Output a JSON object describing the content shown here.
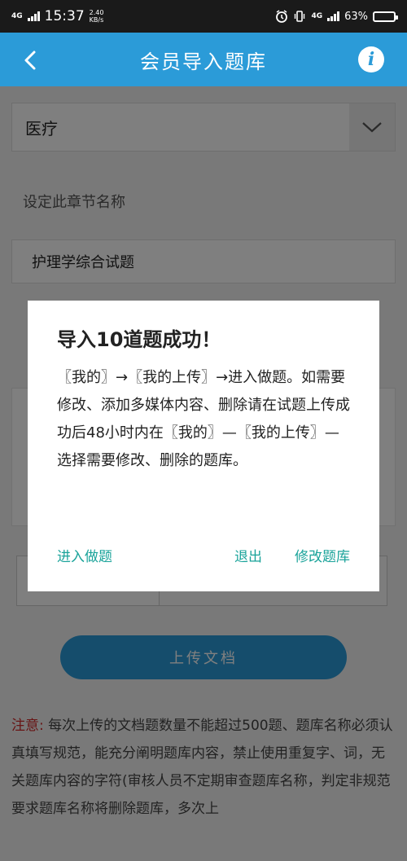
{
  "status_bar": {
    "network": "4G",
    "time": "15:37",
    "speed_value": "2.40",
    "speed_unit": "KB/s",
    "network_right": "4G",
    "battery_text": "63%",
    "battery_level": 0.63
  },
  "header": {
    "title": "会员导入题库",
    "back_icon": "chevron-left-icon",
    "info_icon": "info-icon",
    "info_glyph": "i"
  },
  "form": {
    "category_value": "医疗",
    "chapter_label": "设定此章节名称",
    "chapter_value": "护理学综合试题",
    "upload_label": "上传文档"
  },
  "notice": {
    "label": "注意:",
    "text": "每次上传的文档题数量不能超过500题、题库名称必须认真填写规范，能充分阐明题库内容，禁止使用重复字、词，无关题库内容的字符(审核人员不定期审查题库名称，判定非规范要求题库名称将删除题库，多次上"
  },
  "dialog": {
    "title": "导入10道题成功！",
    "message": "〖我的〗→〖我的上传〗→进入做题。如需要修改、添加多媒体内容、删除请在试题上传成功后48小时内在〖我的〗—〖我的上传〗—选择需要修改、删除的题库。",
    "actions": {
      "enter": "进入做题",
      "exit": "退出",
      "edit": "修改题库"
    }
  },
  "colors": {
    "primary": "#2b9bd8",
    "action_text": "#1aa39a",
    "notice_label": "#d12b2b"
  }
}
